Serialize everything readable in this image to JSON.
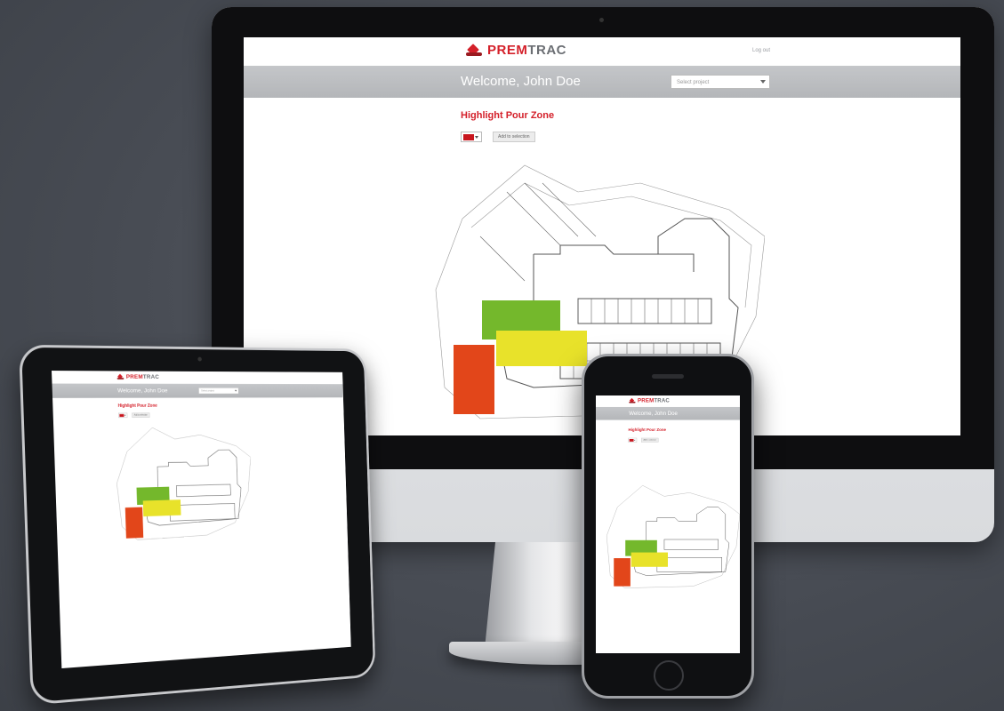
{
  "brand": {
    "prefix": "PREM",
    "suffix": "TRAC",
    "color_primary": "#d4202a",
    "color_secondary": "#6b6e73"
  },
  "header": {
    "top_link": "Log out",
    "welcome": "Welcome, John Doe",
    "project_select_placeholder": "Select project"
  },
  "main": {
    "heading": "Highlight Pour Zone",
    "selected_color": "#c8161e",
    "action_button": "Add to selection"
  },
  "zones": [
    {
      "name": "green",
      "color": "#74b82c"
    },
    {
      "name": "yellow",
      "color": "#e8e22a"
    },
    {
      "name": "red",
      "color": "#e2461a"
    }
  ]
}
